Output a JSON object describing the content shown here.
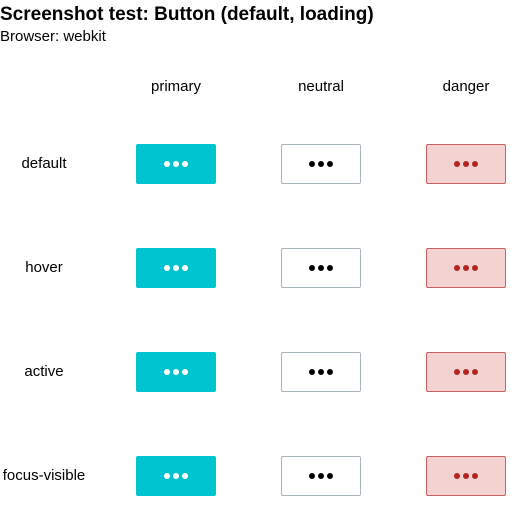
{
  "header": {
    "title": "Screenshot test: Button (default, loading)",
    "browser_line": "Browser: webkit"
  },
  "columns": [
    "primary",
    "neutral",
    "danger"
  ],
  "rows": [
    "default",
    "hover",
    "active",
    "focus-visible"
  ],
  "buttons": {
    "state": "loading",
    "indicator": "ellipsis-dots-icon",
    "colors": {
      "primary": {
        "background": "#00c3d0",
        "dots": "#ffffff"
      },
      "neutral": {
        "background": "#ffffff",
        "border": "#a7b5bb",
        "dots": "#000000"
      },
      "danger": {
        "background": "#f3d2d2",
        "border": "#c76060",
        "dots": "#b3261e"
      }
    }
  }
}
